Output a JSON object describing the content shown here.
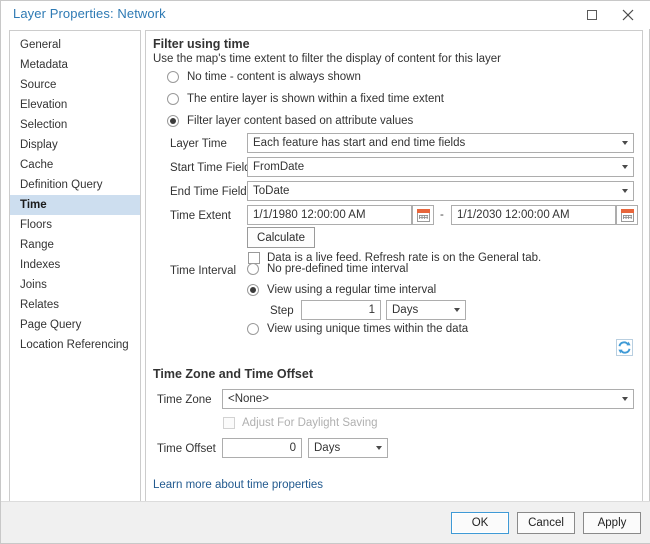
{
  "window": {
    "title": "Layer Properties: Network",
    "maximize_label": "Maximize",
    "close_label": "Close"
  },
  "sidebar": {
    "items": [
      {
        "label": "General",
        "selected": false
      },
      {
        "label": "Metadata",
        "selected": false
      },
      {
        "label": "Source",
        "selected": false
      },
      {
        "label": "Elevation",
        "selected": false
      },
      {
        "label": "Selection",
        "selected": false
      },
      {
        "label": "Display",
        "selected": false
      },
      {
        "label": "Cache",
        "selected": false
      },
      {
        "label": "Definition Query",
        "selected": false
      },
      {
        "label": "Time",
        "selected": true
      },
      {
        "label": "Floors",
        "selected": false
      },
      {
        "label": "Range",
        "selected": false
      },
      {
        "label": "Indexes",
        "selected": false
      },
      {
        "label": "Joins",
        "selected": false
      },
      {
        "label": "Relates",
        "selected": false
      },
      {
        "label": "Page Query",
        "selected": false
      },
      {
        "label": "Location Referencing",
        "selected": false
      }
    ]
  },
  "filter_section": {
    "heading": "Filter using time",
    "description": "Use the map's time extent to filter the display of content for this layer",
    "options": [
      {
        "label": "No time - content is always shown",
        "checked": false
      },
      {
        "label": "The entire layer is shown within a fixed time extent",
        "checked": false
      },
      {
        "label": "Filter layer content based on attribute values",
        "checked": true
      }
    ]
  },
  "fields": {
    "layer_time_label": "Layer Time",
    "layer_time_value": "Each feature has start and end time fields",
    "start_time_label": "Start Time Field",
    "start_time_value": "FromDate",
    "end_time_label": "End Time Field",
    "end_time_value": "ToDate"
  },
  "time_extent": {
    "label": "Time Extent",
    "start_value": "1/1/1980 12:00:00 AM",
    "end_value": "1/1/2030 12:00:00 AM",
    "separator": "-",
    "start_calendar_icon": "calendar-icon",
    "end_calendar_icon": "calendar-icon",
    "calculate_label": "Calculate",
    "live_feed_label": "Data is a live feed. Refresh rate is on the General tab.",
    "live_feed_checked": false
  },
  "time_interval": {
    "label": "Time Interval",
    "options": [
      {
        "label": "No pre-defined time interval",
        "checked": false
      },
      {
        "label": "View using a regular time interval",
        "checked": true
      },
      {
        "label": "View using unique times within the data",
        "checked": false
      }
    ],
    "step_label": "Step",
    "step_value": "1",
    "step_unit": "Days",
    "refresh_icon": "refresh-icon"
  },
  "time_zone_section": {
    "heading": "Time Zone and Time Offset",
    "time_zone_label": "Time Zone",
    "time_zone_value": "<None>",
    "daylight_label": "Adjust For Daylight Saving",
    "daylight_checked": false,
    "time_offset_label": "Time Offset",
    "time_offset_value": "0",
    "time_offset_unit": "Days"
  },
  "help_link": "Learn more about time properties",
  "footer": {
    "ok_label": "OK",
    "cancel_label": "Cancel",
    "apply_label": "Apply"
  },
  "colors": {
    "title": "#2e7ab4",
    "selected_nav": "#cddeef",
    "link": "#225a8f",
    "accent": "#3f9ad6",
    "calendar_accent": "#e8663c"
  }
}
